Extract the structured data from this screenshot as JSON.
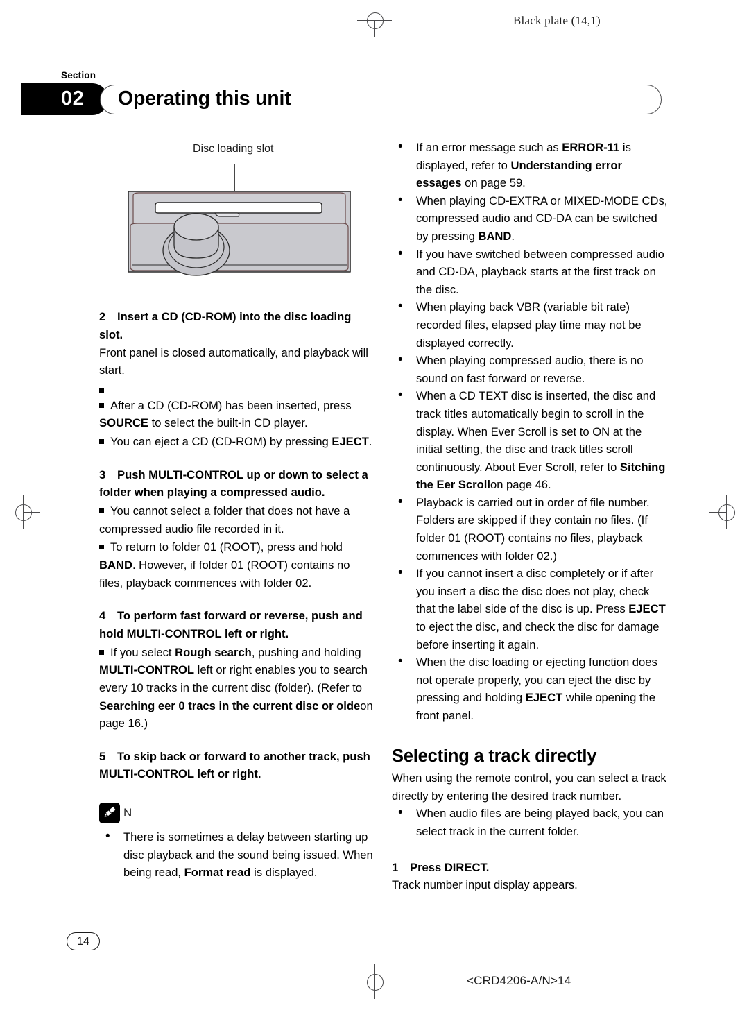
{
  "page": {
    "plate_label": "Black plate (14,1)",
    "footer_code": "<CRD4206-A/N>14",
    "page_number": "14"
  },
  "header": {
    "section_word": "Section",
    "section_number": "02",
    "title": "Operating this unit"
  },
  "figure": {
    "caption": "Disc loading slot"
  },
  "left_column": {
    "step2": {
      "number": "2",
      "title": "Insert a CD (CD-ROM) into the disc loading slot.",
      "body": "Front panel is closed automatically, and playback will start.",
      "notes": [
        "",
        "After a CD (CD-ROM) has been inserted, press SOURCE to select the built-in CD player.",
        "You can eject a CD (CD-ROM) by pressing EJECT."
      ]
    },
    "step3": {
      "number": "3",
      "title": "Push MULTI-CONTROL up or down to select a folder when playing a compressed audio.",
      "notes": [
        "You cannot select a folder that does not have a compressed audio file recorded in it.",
        "To return to folder 01 (ROOT), press and hold BAND. However, if folder 01 (ROOT) contains no files, playback commences with folder 02."
      ]
    },
    "step4": {
      "number": "4",
      "title": "To perform fast forward or reverse, push and hold MULTI-CONTROL left or right.",
      "notes": [
        "If you select Rough search, pushing and holding MULTI-CONTROL left or right enables you to search every 10 tracks in the current disc (folder). (Refer to Searching eer 0 tracs in the current disc or olderon page 16.)"
      ]
    },
    "step5": {
      "number": "5",
      "title": "To skip back or forward to another track, push MULTI-CONTROL left or right."
    },
    "note_block": {
      "icon": "pencil-icon",
      "label": "N",
      "items": [
        "There is sometimes a delay between starting up disc playback and the sound being issued. When being read, Format read is displayed."
      ]
    }
  },
  "right_column": {
    "bullets": [
      "If an error message such as ERROR-11 is displayed, refer to Understanding error essages on page 59.",
      "When playing CD-EXTRA or MIXED-MODE CDs, compressed audio and CD-DA can be switched by pressing BAND.",
      "If you have switched between compressed audio and CD-DA, playback starts at the first track on the disc.",
      "When playing back VBR (variable bit rate) recorded files, elapsed play time may not be displayed correctly.",
      "When playing compressed audio, there is no sound on fast forward or reverse.",
      "When a CD TEXT disc is inserted, the disc and track titles automatically begin to scroll in the display. When Ever Scroll is set to ON at the initial setting, the disc and track titles scroll continuously. About Ever Scroll, refer to Sitching the Eer Scroll on page 46.",
      "Playback is carried out in order of file number. Folders are skipped if they contain no files. (If folder 01 (ROOT) contains no files, playback commences with folder 02.)",
      "If you cannot insert a disc completely or if after you insert a disc the disc does not play, check that the label side of the disc is up. Press EJECT to eject the disc, and check the disc for damage before inserting it again.",
      "When the disc loading or ejecting function does not operate properly, you can eject the disc by pressing and holding EJECT while opening the front panel."
    ],
    "heading": "Selecting a track directly",
    "intro": "When using the remote control, you can select a track directly by entering the desired track number.",
    "intro_bullets": [
      "When audio files are being played back, you can select track in the current folder."
    ],
    "step1": {
      "number": "1",
      "title": "Press DIRECT.",
      "body": "Track number input display appears."
    }
  }
}
